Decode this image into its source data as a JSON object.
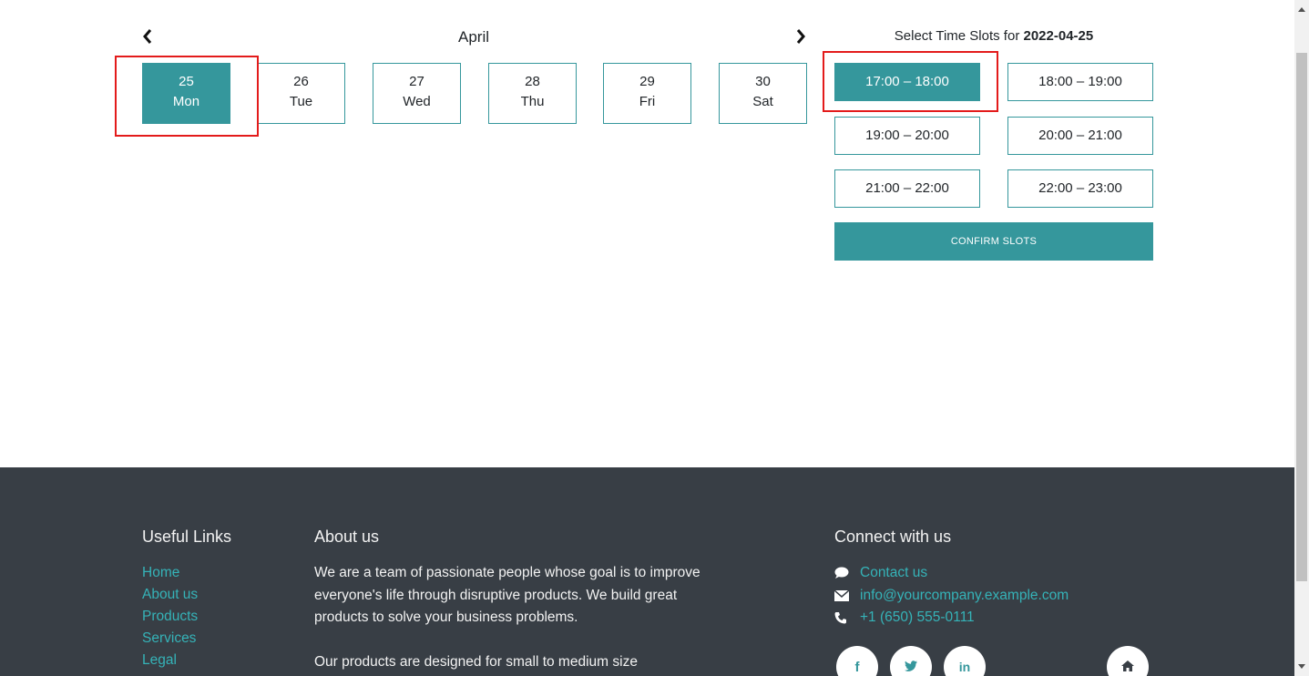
{
  "calendar": {
    "month": "April",
    "prev_icon": "chevron-left-icon",
    "next_icon": "chevron-right-icon",
    "days": [
      {
        "num": "25",
        "dow": "Mon",
        "selected": true
      },
      {
        "num": "26",
        "dow": "Tue",
        "selected": false
      },
      {
        "num": "27",
        "dow": "Wed",
        "selected": false
      },
      {
        "num": "28",
        "dow": "Thu",
        "selected": false
      },
      {
        "num": "29",
        "dow": "Fri",
        "selected": false
      },
      {
        "num": "30",
        "dow": "Sat",
        "selected": false
      }
    ]
  },
  "slots": {
    "title_prefix": "Select Time Slots for",
    "date": "2022-04-25",
    "items": [
      {
        "label": "17:00 – 18:00",
        "selected": true
      },
      {
        "label": "18:00 – 19:00",
        "selected": false
      },
      {
        "label": "19:00 – 20:00",
        "selected": false
      },
      {
        "label": "20:00 – 21:00",
        "selected": false
      },
      {
        "label": "21:00 – 22:00",
        "selected": false
      },
      {
        "label": "22:00 – 23:00",
        "selected": false
      }
    ],
    "confirm_label": "CONFIRM SLOTS"
  },
  "footer": {
    "useful_links": {
      "heading": "Useful Links",
      "items": [
        "Home",
        "About us",
        "Products",
        "Services",
        "Legal"
      ]
    },
    "about": {
      "heading": "About us",
      "p1": "We are a team of passionate people whose goal is to improve everyone's life through disruptive products. We build great products to solve your business problems.",
      "p2": "Our products are designed for small to medium size"
    },
    "connect": {
      "heading": "Connect with us",
      "items": [
        {
          "icon": "comment-icon",
          "label": "Contact us"
        },
        {
          "icon": "envelope-icon",
          "label": "info@yourcompany.example.com"
        },
        {
          "icon": "phone-icon",
          "label": "+1 (650) 555-0111"
        }
      ],
      "social": [
        {
          "icon": "facebook-icon",
          "glyph": "f"
        },
        {
          "icon": "twitter-icon",
          "glyph": ""
        },
        {
          "icon": "linkedin-icon",
          "glyph": "in"
        },
        {
          "icon": "home-icon",
          "glyph": ""
        }
      ]
    }
  },
  "colors": {
    "accent": "#35979c",
    "footer_bg": "#383e45",
    "link": "#35b3b8",
    "highlight": "#e31b1b"
  }
}
